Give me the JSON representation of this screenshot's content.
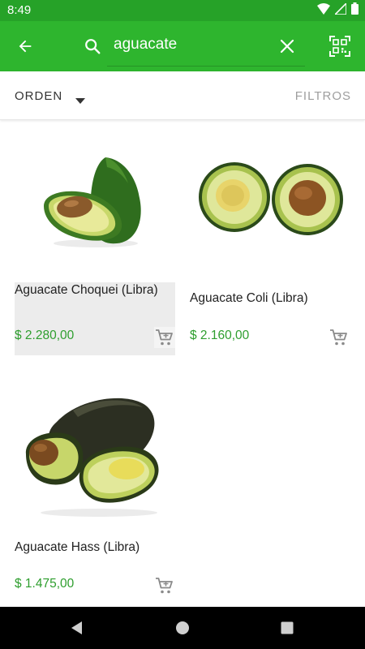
{
  "status": {
    "time": "8:49"
  },
  "header": {
    "search_value": "aguacate",
    "icons": [
      "arrow-left-icon",
      "search-icon",
      "close-icon",
      "qr-scan-icon"
    ]
  },
  "sortbar": {
    "order_label": "ORDEN",
    "filters_label": "FILTROS"
  },
  "colors": {
    "brand_green": "#2eb52e",
    "status_green": "#26a228",
    "price_green": "#2e9e2e"
  },
  "products": [
    {
      "name": "Aguacate Choquei (Libra)",
      "price": "$ 2.280,00"
    },
    {
      "name": "Aguacate Coli (Libra)",
      "price": "$ 2.160,00"
    },
    {
      "name": "Aguacate Hass (Libra)",
      "price": "$ 1.475,00"
    }
  ]
}
